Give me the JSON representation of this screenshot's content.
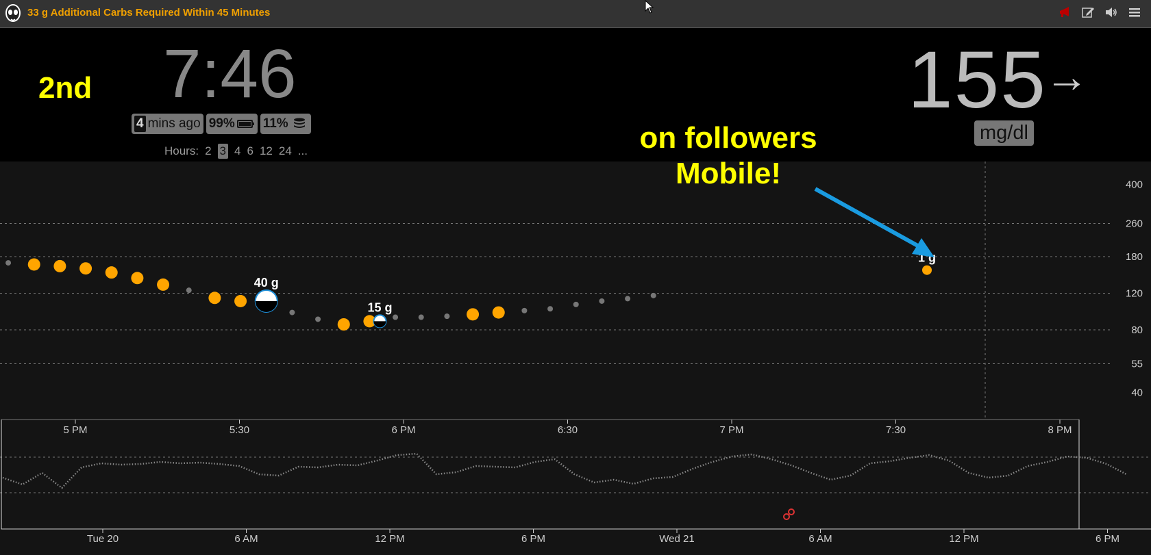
{
  "header": {
    "title": "33 g Additional Carbs Required Within 45 Minutes",
    "title_color": "#f0a000",
    "icons": [
      "megaphone-icon",
      "edit-icon",
      "volume-icon",
      "menu-icon"
    ]
  },
  "status": {
    "label": "2nd"
  },
  "clock": {
    "time": "7:46"
  },
  "pills": {
    "ago_num": "4",
    "ago_text": "mins ago",
    "battery": "99%",
    "battery_icon": "battery-icon",
    "reservoir": "11%",
    "reservoir_icon": "database-icon"
  },
  "hours": {
    "label": "Hours:",
    "options": [
      "2",
      "3",
      "4",
      "6",
      "12",
      "24",
      "..."
    ],
    "selected": "3"
  },
  "bg": {
    "value": "155",
    "direction": "→",
    "units": "mg/dl"
  },
  "overlay": {
    "line1": "on followers",
    "line2": "Mobile!",
    "color": "#ffff00",
    "arrow_color": "#1a9be0"
  },
  "colors": {
    "treatment": "#ffa500",
    "reading": "#777777",
    "insulin": "#1f8fd8"
  },
  "chart_data": {
    "type": "scatter",
    "y_ticks": [
      "400",
      "260",
      "180",
      "120",
      "80",
      "55",
      "40"
    ],
    "y_scale": "log",
    "x_ticks": [
      "5 PM",
      "5:30",
      "6 PM",
      "6:30",
      "7 PM",
      "7:30",
      "8 PM"
    ],
    "carbs": [
      {
        "label": "40 g",
        "time": "5:37 PM",
        "value": 110
      },
      {
        "label": "15 g",
        "time": "5:59 PM",
        "value": 88
      },
      {
        "label": "1 g",
        "time": "7:45 PM",
        "value": 155
      }
    ],
    "readings": [
      {
        "time": "4:47 PM",
        "value": 168,
        "kind": "small"
      },
      {
        "time": "4:52 PM",
        "value": 165,
        "kind": "big"
      },
      {
        "time": "4:57 PM",
        "value": 162,
        "kind": "big"
      },
      {
        "time": "5:02 PM",
        "value": 158,
        "kind": "big"
      },
      {
        "time": "5:07 PM",
        "value": 151,
        "kind": "big"
      },
      {
        "time": "5:12 PM",
        "value": 142,
        "kind": "big"
      },
      {
        "time": "5:17 PM",
        "value": 132,
        "kind": "big"
      },
      {
        "time": "5:22 PM",
        "value": 124,
        "kind": "small"
      },
      {
        "time": "5:27 PM",
        "value": 114,
        "kind": "big"
      },
      {
        "time": "5:32 PM",
        "value": 110,
        "kind": "big"
      },
      {
        "time": "5:42 PM",
        "value": 97,
        "kind": "small"
      },
      {
        "time": "5:47 PM",
        "value": 90,
        "kind": "small"
      },
      {
        "time": "5:52 PM",
        "value": 85,
        "kind": "big"
      },
      {
        "time": "5:57 PM",
        "value": 88,
        "kind": "big"
      },
      {
        "time": "6:02 PM",
        "value": 92,
        "kind": "small"
      },
      {
        "time": "6:07 PM",
        "value": 92,
        "kind": "small"
      },
      {
        "time": "6:12 PM",
        "value": 93,
        "kind": "small"
      },
      {
        "time": "6:17 PM",
        "value": 95,
        "kind": "big"
      },
      {
        "time": "6:22 PM",
        "value": 97,
        "kind": "big"
      },
      {
        "time": "6:27 PM",
        "value": 99,
        "kind": "small"
      },
      {
        "time": "6:32 PM",
        "value": 101,
        "kind": "small"
      },
      {
        "time": "6:37 PM",
        "value": 106,
        "kind": "small"
      },
      {
        "time": "6:42 PM",
        "value": 110,
        "kind": "small"
      },
      {
        "time": "6:47 PM",
        "value": 113,
        "kind": "small"
      },
      {
        "time": "6:52 PM",
        "value": 117,
        "kind": "small"
      }
    ],
    "context_ticks": [
      "Tue 20",
      "6 AM",
      "12 PM",
      "6 PM",
      "Wed 21",
      "6 AM",
      "12 PM",
      "6 PM"
    ],
    "context_series": [
      55,
      45,
      62,
      40,
      70,
      76,
      74,
      75,
      78,
      76,
      77,
      75,
      72,
      60,
      58,
      71,
      70,
      74,
      73,
      80,
      88,
      90,
      60,
      63,
      72,
      71,
      70,
      78,
      82,
      60,
      48,
      52,
      46,
      54,
      56,
      68,
      78,
      86,
      89,
      82,
      73,
      62,
      52,
      58,
      76,
      79,
      84,
      88,
      80,
      62,
      55,
      58,
      72,
      78,
      86,
      84,
      75,
      60
    ]
  }
}
